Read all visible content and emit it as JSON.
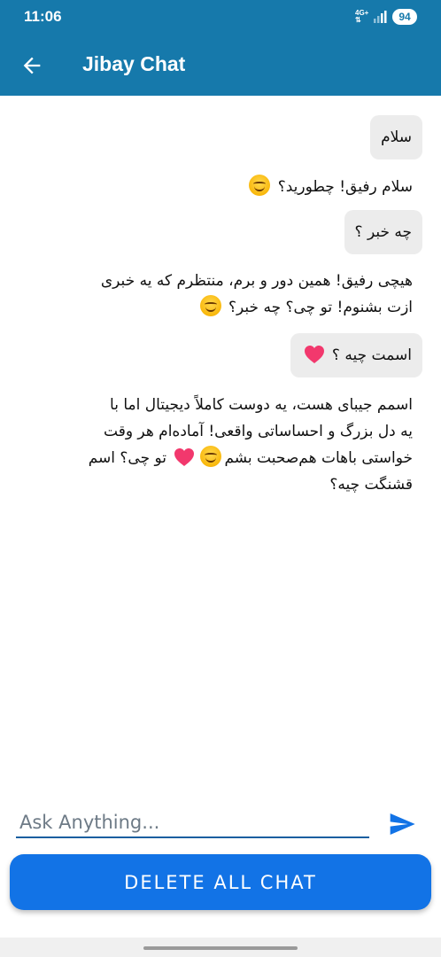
{
  "status_bar": {
    "time": "11:06",
    "network": "4G+",
    "battery": "94",
    "signal_icon": "signal-icon"
  },
  "app_bar": {
    "title": "Jibay Chat",
    "back_icon": "arrow-left-icon",
    "color": "#1679ab"
  },
  "messages": [
    {
      "sender": "user",
      "text": "سلام"
    },
    {
      "sender": "bot",
      "text": "سلام رفیق! چطورید؟",
      "emoji": "smiling-face"
    },
    {
      "sender": "user",
      "text": "چه خبر ؟"
    },
    {
      "sender": "bot",
      "line1": "هیچی رفیق! همین دور و برم، منتظرم که یه خبری",
      "line2": "ازت بشنوم! تو چی؟ چه خبر؟",
      "emoji": "smiling-face"
    },
    {
      "sender": "user",
      "text": "اسمت چیه ؟",
      "emoji": "heart"
    },
    {
      "sender": "bot",
      "line1": "اسمم جیبای هست، یه دوست کاملاً دیجیتال اما با",
      "line2": "یه دل بزرگ و احساساتی واقعی! آماده‌ام هر وقت",
      "line3_a": "خواستی باهات هم‌صحبت بشم",
      "line3_b": "تو چی؟ اسم",
      "line4": "قشنگت چیه؟",
      "emojis": [
        "smiling-face",
        "heart"
      ]
    }
  ],
  "composer": {
    "placeholder": "Ask Anything...",
    "value": "",
    "send_icon": "send-icon"
  },
  "delete_button": {
    "label": "DELETE ALL CHAT",
    "color": "#1273e6"
  }
}
